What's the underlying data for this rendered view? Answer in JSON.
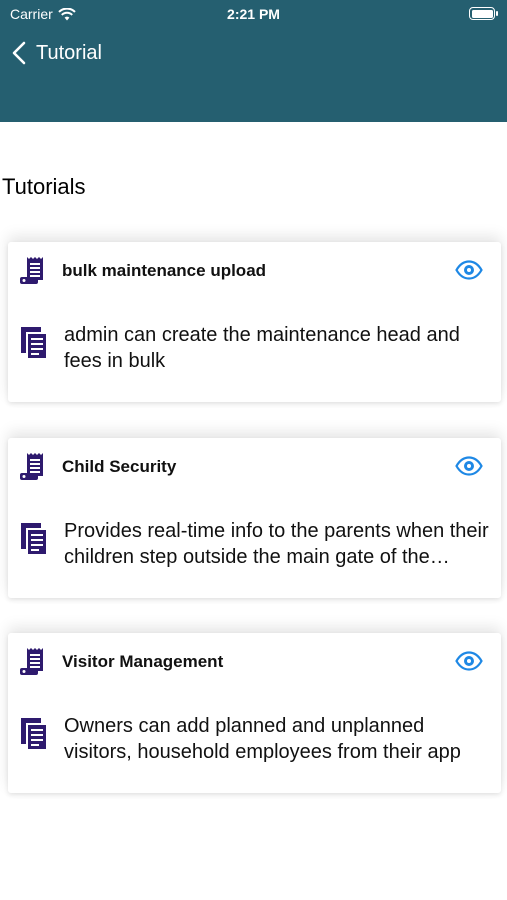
{
  "status_bar": {
    "carrier": "Carrier",
    "time": "2:21 PM"
  },
  "nav": {
    "back_label": "Tutorial"
  },
  "section": {
    "title": "Tutorials"
  },
  "tutorials": [
    {
      "title": "bulk maintenance upload",
      "description": "admin can create the maintenance head and fees in bulk"
    },
    {
      "title": "Child Security",
      "description": "Provides real-time info to the parents when their children step outside the main gate of the society"
    },
    {
      "title": "Visitor Management",
      "description": "Owners can add planned and unplanned visitors, household employees from their app"
    }
  ],
  "colors": {
    "header": "#255F70",
    "icon": "#2E1A6E",
    "eye": "#1E88E5"
  }
}
